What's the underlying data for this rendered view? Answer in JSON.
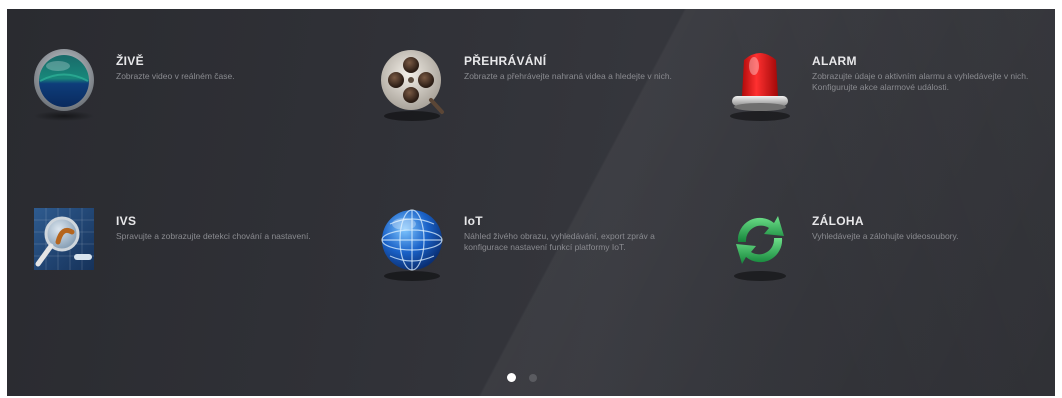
{
  "tiles": [
    {
      "id": "live",
      "title": "ŽIVĚ",
      "desc": "Zobrazte video v reálném čase.",
      "icon": "live-lens-icon"
    },
    {
      "id": "playback",
      "title": "PŘEHRÁVÁNÍ",
      "desc": "Zobrazte a přehrávejte nahraná videa a hledejte v nich.",
      "icon": "film-reel-icon"
    },
    {
      "id": "alarm",
      "title": "ALARM",
      "desc": "Zobrazujte údaje o aktivním alarmu a vyhledávejte v nich. Konfigurujte akce alarmové události.",
      "icon": "alarm-siren-icon"
    },
    {
      "id": "ivs",
      "title": "IVS",
      "desc": "Spravujte a zobrazujte detekci chování a nastavení.",
      "icon": "ivs-magnifier-icon"
    },
    {
      "id": "iot",
      "title": "IoT",
      "desc": "Náhled živého obrazu, vyhledávání, export zpráv a konfigurace nastavení funkcí platformy IoT.",
      "icon": "globe-icon"
    },
    {
      "id": "backup",
      "title": "ZÁLOHA",
      "desc": "Vyhledávejte a zálohujte videosoubory.",
      "icon": "sync-arrows-icon"
    }
  ],
  "pagination": {
    "current": 1,
    "total": 2
  },
  "colors": {
    "background": "#303137",
    "title": "#e8e8ea",
    "description": "#8a8b90",
    "dot_active": "#ffffff",
    "dot_inactive": "#5a5b60"
  }
}
